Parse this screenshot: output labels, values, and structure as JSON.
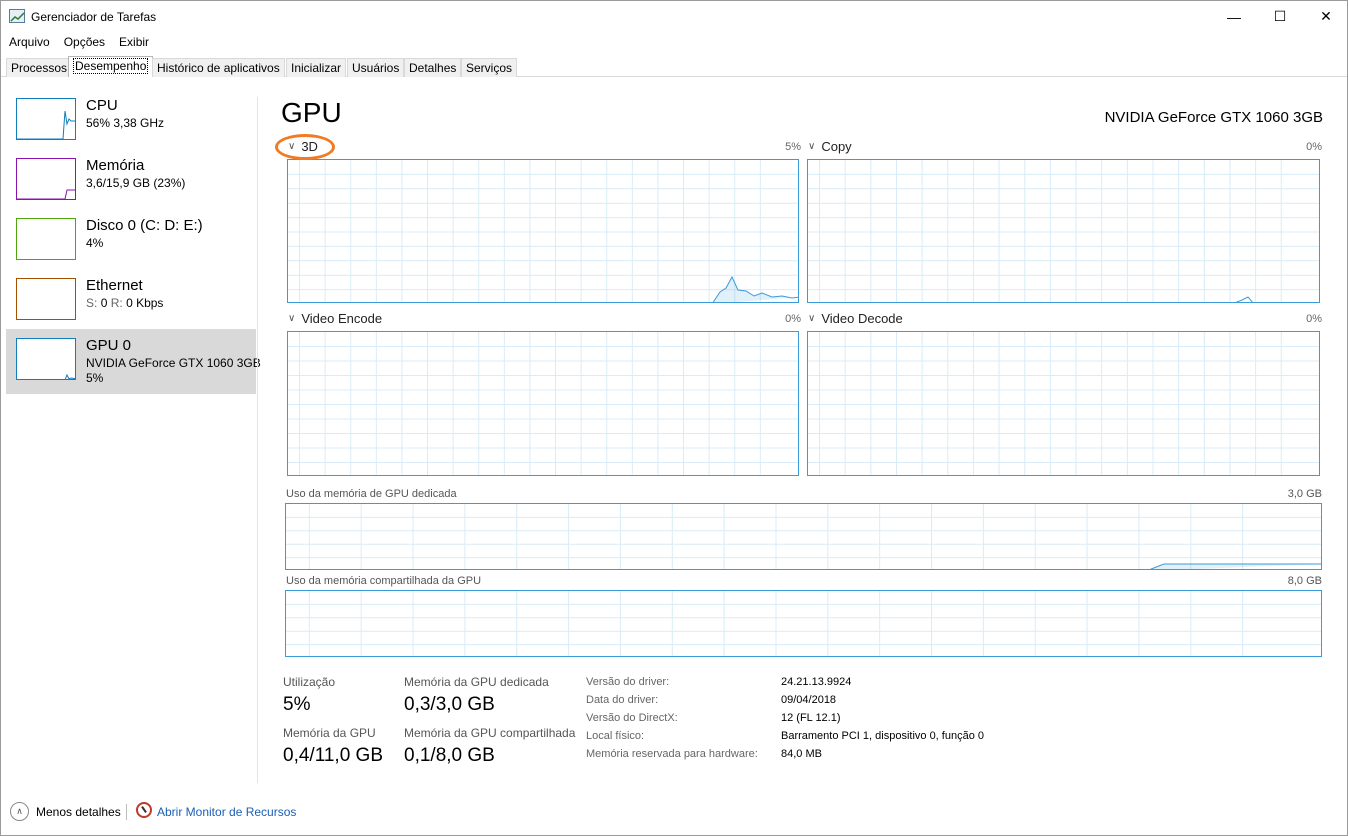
{
  "window": {
    "title": "Gerenciador de Tarefas",
    "minimize": "—",
    "maximize": "☐",
    "close": "✕"
  },
  "menu": [
    "Arquivo",
    "Opções",
    "Exibir"
  ],
  "tabs": [
    "Processos",
    "Desempenho",
    "Histórico de aplicativos",
    "Inicializar",
    "Usuários",
    "Detalhes",
    "Serviços"
  ],
  "active_tab": "Desempenho",
  "sidebar": [
    {
      "title": "CPU",
      "sub": "56% 3,38 GHz",
      "color": "#117dbb"
    },
    {
      "title": "Memória",
      "sub": "3,6/15,9 GB (23%)",
      "color": "#8b12ae"
    },
    {
      "title": "Disco 0 (C: D: E:)",
      "sub": "4%",
      "color": "#4da60c"
    },
    {
      "title": "Ethernet",
      "sub_s_label": "S:",
      "sub_s": "0",
      "sub_r_label": "R:",
      "sub_r": "0 Kbps",
      "color": "#a74f01"
    },
    {
      "title": "GPU 0",
      "sub": "NVIDIA GeForce GTX 1060 3GB",
      "sub2": "5%",
      "color": "#117dbb",
      "selected": true
    }
  ],
  "main": {
    "title": "GPU",
    "device_name": "NVIDIA GeForce GTX 1060 3GB",
    "graphs": [
      {
        "label": "3D",
        "pct": "5%"
      },
      {
        "label": "Copy",
        "pct": "0%"
      },
      {
        "label": "Video Encode",
        "pct": "0%"
      },
      {
        "label": "Video Decode",
        "pct": "0%"
      }
    ],
    "dedicated_mem_label": "Uso da memória de GPU dedicada",
    "dedicated_mem_max": "3,0 GB",
    "shared_mem_label": "Uso da memória compartilhada da GPU",
    "shared_mem_max": "8,0 GB"
  },
  "stats": {
    "utilization_label": "Utilização",
    "utilization": "5%",
    "dedicated_label": "Memória da GPU dedicada",
    "dedicated": "0,3/3,0 GB",
    "gpu_mem_label": "Memória da GPU",
    "gpu_mem": "0,4/11,0 GB",
    "shared_label": "Memória da GPU compartilhada",
    "shared": "0,1/8,0 GB"
  },
  "info": [
    {
      "label": "Versão do driver:",
      "value": "24.21.13.9924"
    },
    {
      "label": "Data do driver:",
      "value": "09/04/2018"
    },
    {
      "label": "Versão do DirectX:",
      "value": "12 (FL 12.1)"
    },
    {
      "label": "Local físico:",
      "value": "Barramento PCI 1, dispositivo 0, função 0"
    },
    {
      "label": "Memória reservada para hardware:",
      "value": "84,0 MB"
    }
  ],
  "footer": {
    "less_details": "Menos detalhes",
    "resource_monitor": "Abrir Monitor de Recursos"
  },
  "colors": {
    "gpu_line": "#3a9bd9",
    "grid": "#d9ecf7",
    "highlight": "#f07b24"
  }
}
